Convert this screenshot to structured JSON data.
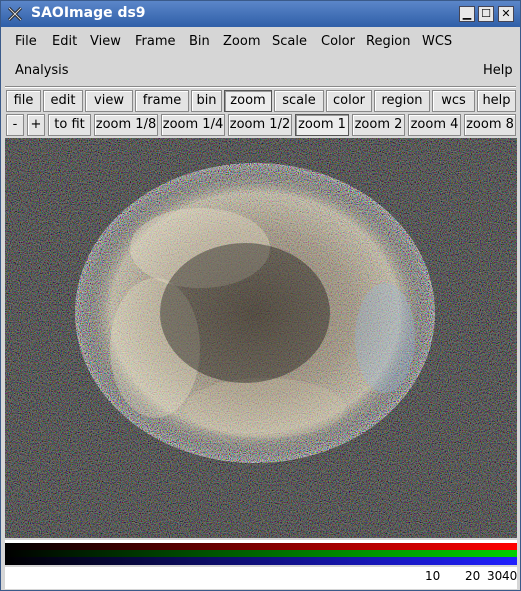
{
  "window": {
    "title": "SAOImage ds9",
    "minimize": "▁",
    "maximize": "☐",
    "close": "✕"
  },
  "menu": {
    "row1": [
      "File",
      "Edit",
      "View",
      "Frame",
      "Bin",
      "Zoom",
      "Scale",
      "Color",
      "Region",
      "WCS"
    ],
    "analysis": "Analysis",
    "help": "Help"
  },
  "buttons": {
    "main": [
      "file",
      "edit",
      "view",
      "frame",
      "bin",
      "zoom",
      "scale",
      "color",
      "region",
      "wcs",
      "help"
    ],
    "active_main": "zoom",
    "zoom": [
      "-",
      "+",
      "to fit",
      "zoom 1/8",
      "zoom 1/4",
      "zoom 1/2",
      "zoom 1",
      "zoom 2",
      "zoom 4",
      "zoom 8"
    ],
    "active_zoom": "zoom 1"
  },
  "colorbar": {
    "ticks": [
      "10",
      "20",
      "30",
      "40"
    ],
    "colors": [
      "#ff0000",
      "#00d000",
      "#2020ff"
    ]
  }
}
